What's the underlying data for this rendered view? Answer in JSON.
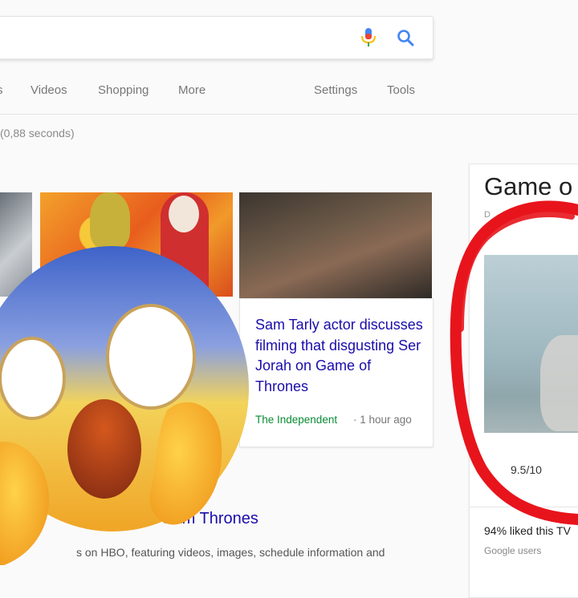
{
  "search": {
    "mic_icon": "mic-icon",
    "search_icon": "search-icon"
  },
  "tabs": {
    "items": [
      {
        "label": "Videos"
      },
      {
        "label": "Shopping"
      },
      {
        "label": "More"
      },
      {
        "label": "Settings"
      },
      {
        "label": "Tools"
      }
    ]
  },
  "results_stats": "(0,88 seconds)",
  "news": {
    "card_title": "Sam Tarly actor discusses filming that disgusting Ser Jorah on Game of Thrones",
    "source": "The Independent",
    "time": "· 1 hour ago"
  },
  "result": {
    "title_fragment": "Gam    Thrones",
    "snippet": "s on HBO, featuring videos, images, schedule information and"
  },
  "knowledge_panel": {
    "title": "Game o",
    "rating": "9.5/10",
    "liked": "94% liked this TV",
    "liked_source": "Google users"
  },
  "overlay": {
    "emoji_icon": "screaming-face-emoji-icon",
    "circle_color": "#e8141c"
  },
  "colors": {
    "link": "#1a0dab",
    "source_green": "#0a8a35",
    "mic_blue": "#4285f4",
    "mic_red": "#ea4335"
  }
}
